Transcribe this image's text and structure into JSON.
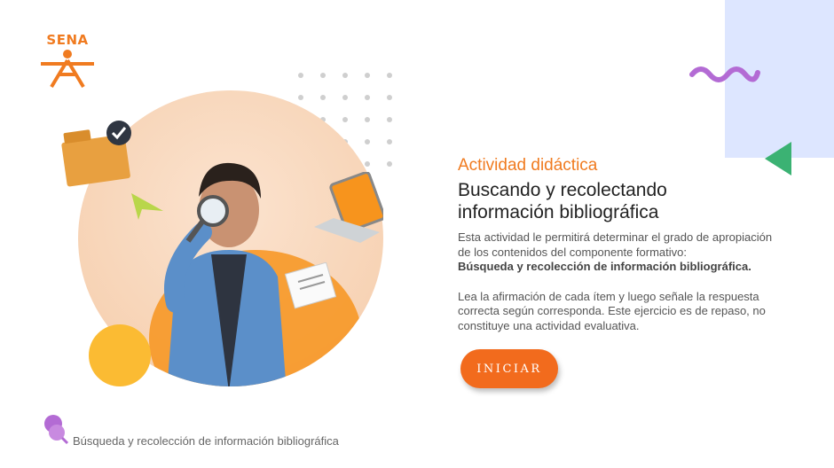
{
  "brand": {
    "logo_text": "SENA",
    "color": "#f07b20"
  },
  "activity": {
    "kicker": "Actividad didáctica",
    "title_line1": "Buscando y recolectando",
    "title_line2": "información bibliográfica",
    "desc_1": "Esta actividad le permitirá determinar el grado de apropiación de los contenidos del componente formativo:",
    "desc_bold": "Búsqueda y recolección de información bibliográfica.",
    "desc_2": "Lea la afirmación de cada ítem y luego señale la respuesta correcta según corresponda.  Este ejercicio es de repaso, no constituye una actividad evaluativa."
  },
  "buttons": {
    "start_label": "INICIAR"
  },
  "footer": {
    "label": "Búsqueda y recolección de información bibliográfica"
  },
  "colors": {
    "accent": "#f26b1d",
    "panel": "#dde6ff",
    "wave": "#b36bd4",
    "triangle": "#3bb273"
  },
  "icons": [
    "folder-check-icon",
    "paper-plane-icon",
    "laptop-icon",
    "document-icon",
    "magnifier-icon",
    "pin-icon",
    "wave-decoration",
    "triangle-decoration"
  ]
}
